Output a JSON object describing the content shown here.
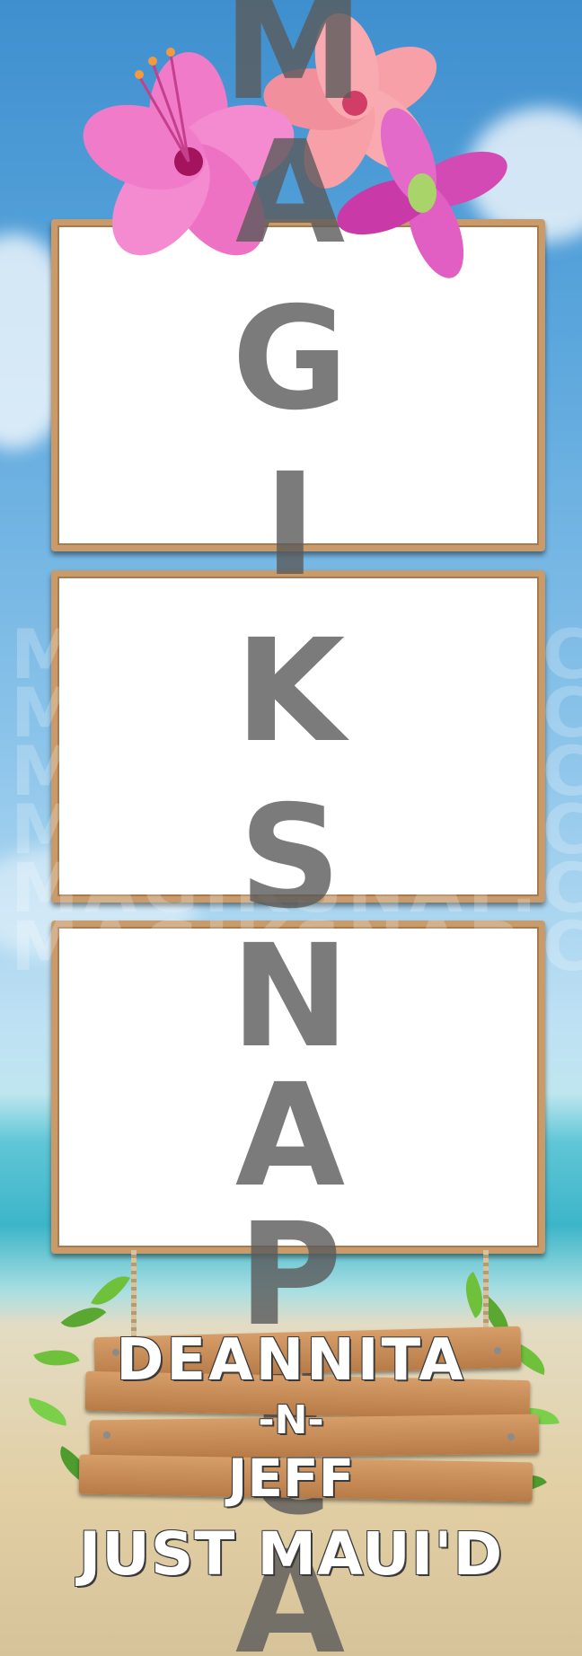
{
  "watermark": {
    "text": "MAGIKSNAP.CA",
    "rows": [
      "MAGIKSNAP.CA",
      "MAGIKSNAP.CA",
      "MAGIKSNAP.CA",
      "MAGIKSNAP.CA",
      "MAGIKSNAP.CA",
      "MAGIKSNAP.CA"
    ]
  },
  "vertical_watermark": [
    "M",
    "A",
    "G",
    "I",
    "K",
    "S",
    "N",
    "A",
    "P",
    "N",
    "C",
    "A"
  ],
  "sign": {
    "line1": "DEANNITA",
    "line2": "-N-",
    "line3": "JEFF",
    "line4": "JUST MAUI'D"
  },
  "colors": {
    "frame_border": "#c99b6b",
    "sign_wood": "#c98b55",
    "flower_pink": "#f07bc8",
    "flower_peach": "#f7a0a8",
    "flower_magenta": "#d44ab5"
  }
}
